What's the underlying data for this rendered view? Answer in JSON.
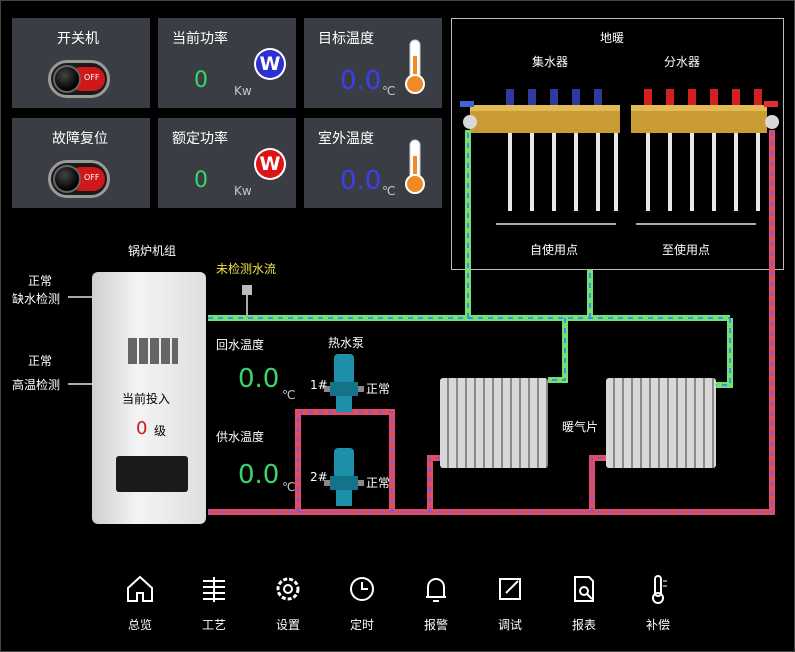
{
  "top_cards": {
    "power_switch": {
      "title": "开关机",
      "state": "OFF"
    },
    "fault_reset": {
      "title": "故障复位",
      "state": "OFF"
    },
    "current_power": {
      "title": "当前功率",
      "value": "0",
      "unit": "Kw",
      "badge": "W",
      "badge_color": "#2d2fd1"
    },
    "rated_power": {
      "title": "额定功率",
      "value": "0",
      "unit": "Kw",
      "badge": "W",
      "badge_color": "#dd1414"
    },
    "target_temp": {
      "title": "目标温度",
      "value": "0.0",
      "unit": "℃"
    },
    "outdoor_temp": {
      "title": "室外温度",
      "value": "0.0",
      "unit": "℃"
    }
  },
  "floor_heating": {
    "title": "地暖",
    "collector": "集水器",
    "distributor": "分水器",
    "self_use": "自使用点",
    "to_use": "至使用点"
  },
  "boiler": {
    "title": "锅炉机组",
    "current_input_label": "当前投入",
    "level_value": "0",
    "level_unit": "级"
  },
  "status_labels": {
    "water_shortage": {
      "state": "正常",
      "label": "缺水检测"
    },
    "overheat": {
      "state": "正常",
      "label": "高温检测"
    },
    "flow_status": "未检测水流"
  },
  "pipes": {
    "return_temp_label": "回水温度",
    "return_temp_value": "0.0",
    "supply_temp_label": "供水温度",
    "supply_temp_value": "0.0",
    "temp_unit": "℃",
    "hot_pump_title": "热水泵",
    "pump1": {
      "id": "1#",
      "state": "正常"
    },
    "pump2": {
      "id": "2#",
      "state": "正常"
    },
    "radiator_label": "暖气片"
  },
  "nav": [
    {
      "label": "总览",
      "icon": "home-icon"
    },
    {
      "label": "工艺",
      "icon": "process-icon"
    },
    {
      "label": "设置",
      "icon": "gear-icon"
    },
    {
      "label": "定时",
      "icon": "clock-icon"
    },
    {
      "label": "报警",
      "icon": "bell-icon"
    },
    {
      "label": "调试",
      "icon": "edit-icon"
    },
    {
      "label": "报表",
      "icon": "report-icon"
    },
    {
      "label": "补偿",
      "icon": "thermometer-icon"
    }
  ]
}
